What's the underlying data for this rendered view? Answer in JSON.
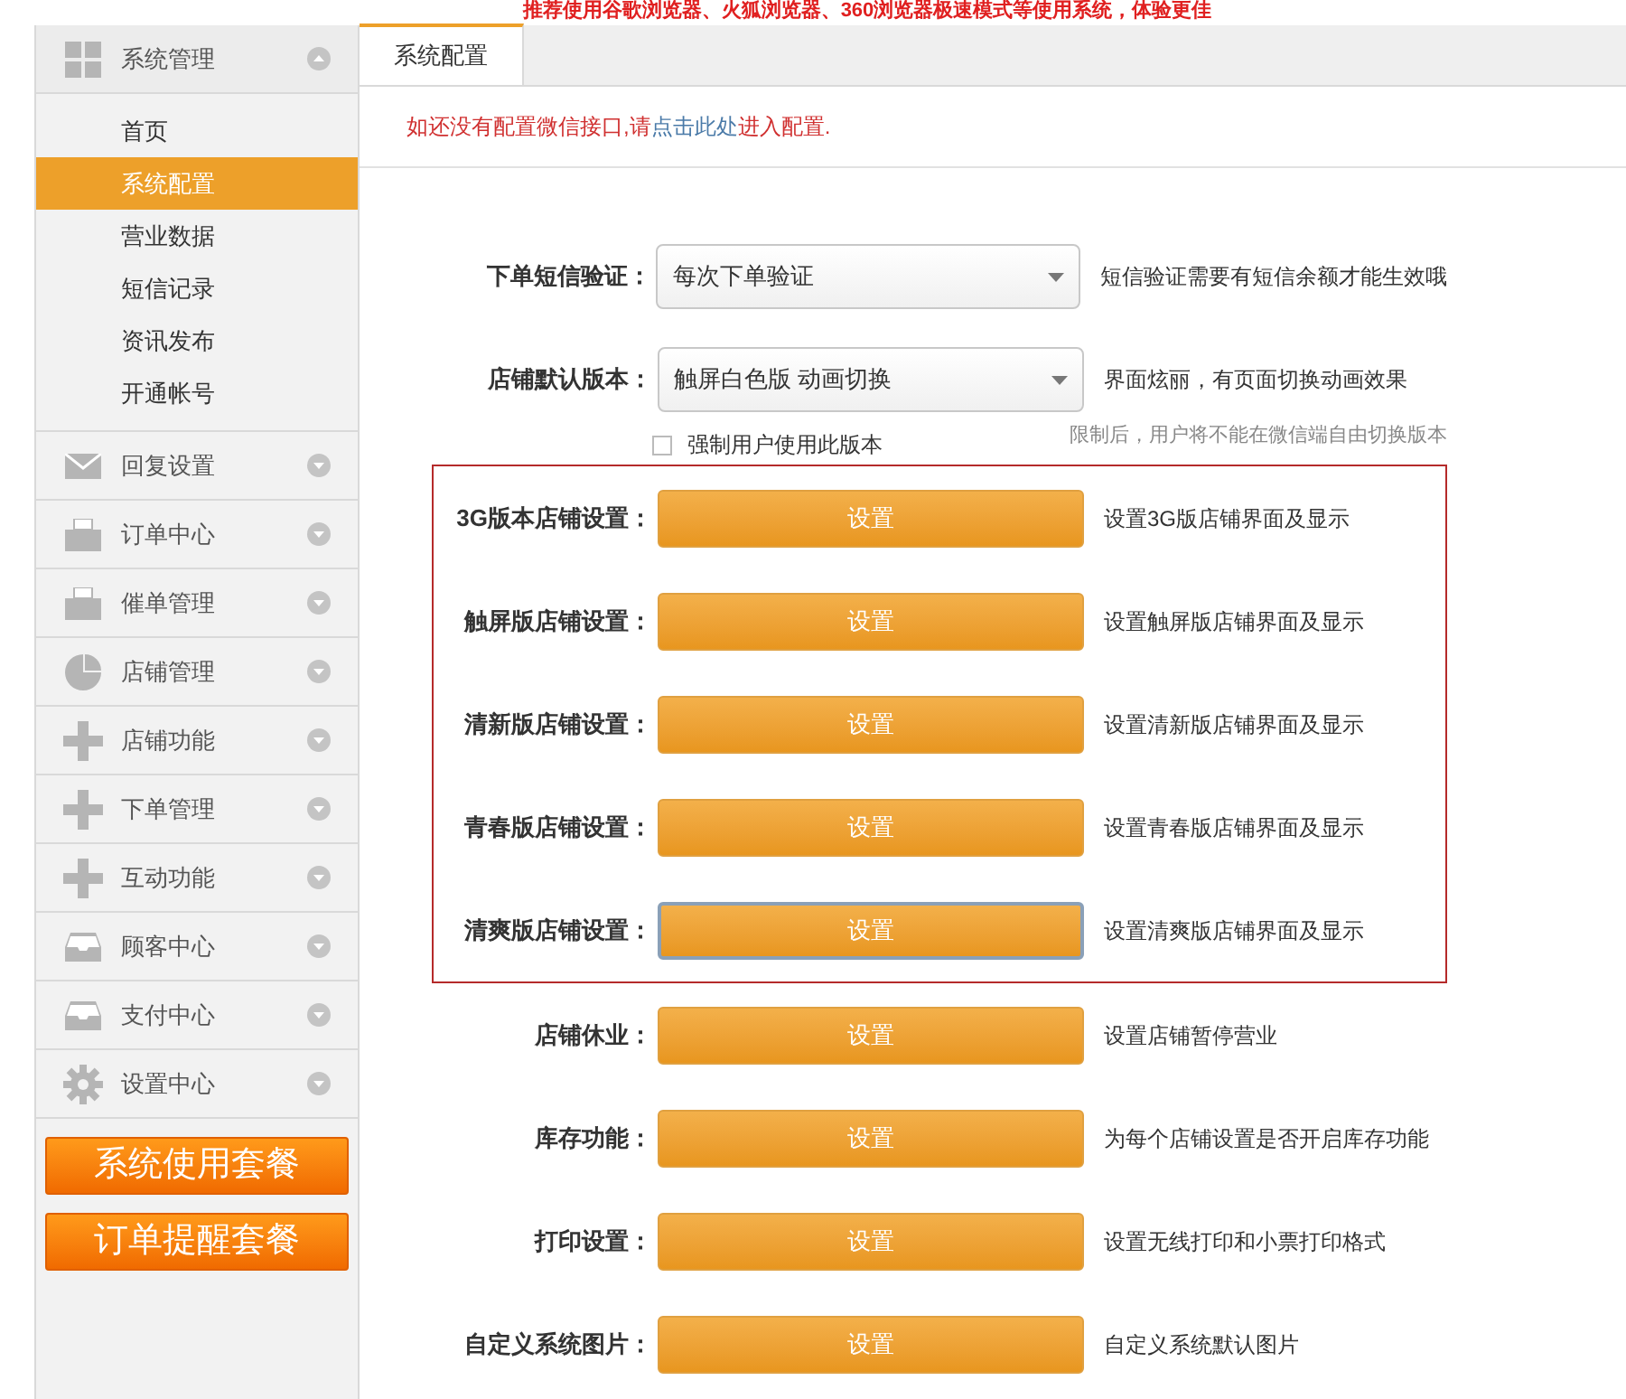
{
  "top_notice": "推荐使用谷歌浏览器、火狐浏览器、360浏览器极速模式等使用系统，体验更佳",
  "sidebar": {
    "groups": [
      {
        "title": "系统管理",
        "kind": "grid",
        "expanded": true,
        "items": [
          {
            "label": "首页",
            "selected": false
          },
          {
            "label": "系统配置",
            "selected": true
          },
          {
            "label": "营业数据",
            "selected": false
          },
          {
            "label": "短信记录",
            "selected": false
          },
          {
            "label": "资讯发布",
            "selected": false
          },
          {
            "label": "开通帐号",
            "selected": false
          }
        ]
      },
      {
        "title": "回复设置",
        "kind": "mail",
        "expanded": false
      },
      {
        "title": "订单中心",
        "kind": "printer",
        "expanded": false
      },
      {
        "title": "催单管理",
        "kind": "printer",
        "expanded": false
      },
      {
        "title": "店铺管理",
        "kind": "pie",
        "expanded": false
      },
      {
        "title": "店铺功能",
        "kind": "plus",
        "expanded": false
      },
      {
        "title": "下单管理",
        "kind": "plus",
        "expanded": false
      },
      {
        "title": "互动功能",
        "kind": "plus",
        "expanded": false
      },
      {
        "title": "顾客中心",
        "kind": "inbox",
        "expanded": false
      },
      {
        "title": "支付中心",
        "kind": "inbox",
        "expanded": false
      },
      {
        "title": "设置中心",
        "kind": "gear",
        "expanded": false
      }
    ],
    "buttons": [
      "系统使用套餐",
      "订单提醒套餐"
    ]
  },
  "tabs": [
    {
      "label": "系统配置",
      "selected": true
    }
  ],
  "notice": {
    "before": "如还没有配置微信接口,请",
    "link": "点击此处",
    "after": "进入配置."
  },
  "form": {
    "sections": [
      {
        "boxed": false,
        "rows": [
          {
            "kind": "select",
            "label": "下单短信验证：",
            "value": "每次下单验证",
            "description": "短信验证需要有短信余额才能生效哦"
          },
          {
            "kind": "select",
            "label": "店铺默认版本：",
            "value": "触屏白色版 动画切换",
            "description": "界面炫丽，有页面切换动画效果",
            "checkbox": {
              "label": "强制用户使用此版本",
              "checked": false
            },
            "note": "限制后，用户将不能在微信端自由切换版本"
          }
        ]
      },
      {
        "boxed": true,
        "rows": [
          {
            "kind": "button",
            "label": "3G版本店铺设置：",
            "button": "设置",
            "focused": false,
            "description": "设置3G版店铺界面及显示"
          },
          {
            "kind": "button",
            "label": "触屏版店铺设置：",
            "button": "设置",
            "focused": false,
            "description": "设置触屏版店铺界面及显示"
          },
          {
            "kind": "button",
            "label": "清新版店铺设置：",
            "button": "设置",
            "focused": false,
            "description": "设置清新版店铺界面及显示"
          },
          {
            "kind": "button",
            "label": "青春版店铺设置：",
            "button": "设置",
            "focused": false,
            "description": "设置青春版店铺界面及显示"
          },
          {
            "kind": "button",
            "label": "清爽版店铺设置：",
            "button": "设置",
            "focused": true,
            "description": "设置清爽版店铺界面及显示"
          }
        ]
      },
      {
        "boxed": false,
        "rows": [
          {
            "kind": "button",
            "label": "店铺休业：",
            "button": "设置",
            "focused": false,
            "description": "设置店铺暂停营业"
          },
          {
            "kind": "button",
            "label": "库存功能：",
            "button": "设置",
            "focused": false,
            "description": "为每个店铺设置是否开启库存功能"
          },
          {
            "kind": "button",
            "label": "打印设置：",
            "button": "设置",
            "focused": false,
            "description": "设置无线打印和小票打印格式"
          },
          {
            "kind": "button",
            "label": "自定义系统图片：",
            "button": "设置",
            "focused": false,
            "description": "自定义系统默认图片"
          }
        ]
      }
    ]
  }
}
